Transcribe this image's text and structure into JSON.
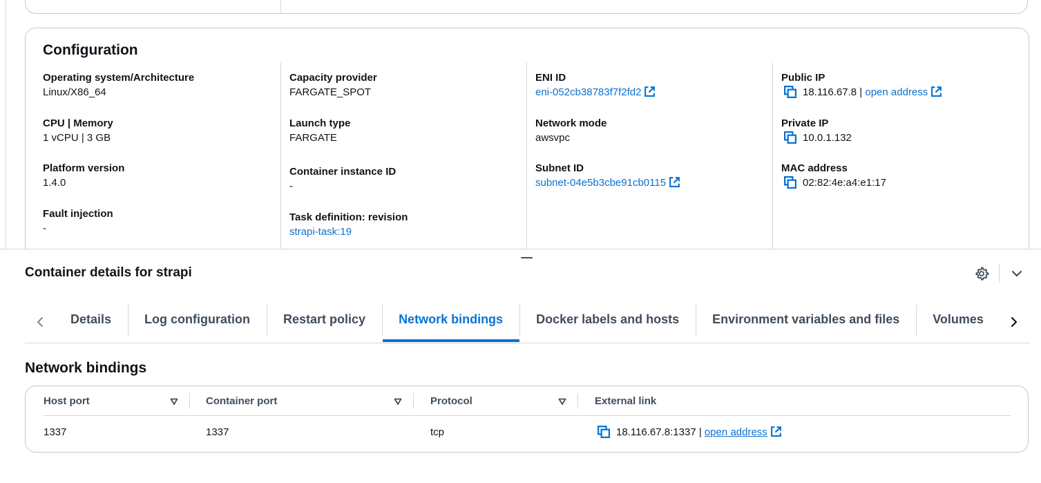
{
  "configuration": {
    "title": "Configuration",
    "columns": [
      {
        "items": [
          {
            "label": "Operating system/Architecture",
            "value": "Linux/X86_64"
          },
          {
            "label": "CPU | Memory",
            "value": "1 vCPU | 3 GB"
          },
          {
            "label": "Platform version",
            "value": "1.4.0"
          },
          {
            "label": "Fault injection",
            "value": "-"
          }
        ]
      },
      {
        "items": [
          {
            "label": "Capacity provider",
            "value": "FARGATE_SPOT"
          },
          {
            "label": "Launch type",
            "value": "FARGATE"
          },
          {
            "label": "Container instance ID",
            "value": "-"
          },
          {
            "label": "Task definition: revision",
            "value": "strapi-task:19"
          }
        ]
      },
      {
        "items": [
          {
            "label": "ENI ID",
            "value": "eni-052cb38783f7f2fd2"
          },
          {
            "label": "Network mode",
            "value": "awsvpc"
          },
          {
            "label": "Subnet ID",
            "value": "subnet-04e5b3cbe91cb0115"
          }
        ]
      },
      {
        "items": [
          {
            "label": "Public IP",
            "value": "18.116.67.8",
            "link": "open address"
          },
          {
            "label": "Private IP",
            "value": "10.0.1.132"
          },
          {
            "label": "MAC address",
            "value": "02:82:4e:a4:e1:17"
          }
        ]
      }
    ]
  },
  "container_details": {
    "title": "Container details for strapi",
    "tabs": [
      {
        "label": "Details"
      },
      {
        "label": "Log configuration"
      },
      {
        "label": "Restart policy"
      },
      {
        "label": "Network bindings"
      },
      {
        "label": "Docker labels and hosts"
      },
      {
        "label": "Environment variables and files"
      },
      {
        "label": "Volumes"
      }
    ],
    "active_tab": "Network bindings"
  },
  "network_bindings": {
    "title": "Network bindings",
    "columns": [
      "Host port",
      "Container port",
      "Protocol",
      "External link"
    ],
    "rows": [
      {
        "host_port": "1337",
        "container_port": "1337",
        "protocol": "tcp",
        "external_link": "18.116.67.8:1337",
        "link_text": "open address"
      }
    ]
  },
  "icons": {
    "copy": "copy-icon",
    "external": "external-link-icon",
    "settings": "gear-icon",
    "collapse": "chevron-down-icon",
    "scroll_left": "chevron-left-icon",
    "scroll_right": "chevron-right-icon",
    "sort": "sort-down-icon"
  },
  "colors": {
    "link": "#0972d3",
    "active_tab": "#0972d3",
    "text": "#0f141a",
    "muted": "#414d5c",
    "border": "#c6c6cd"
  }
}
